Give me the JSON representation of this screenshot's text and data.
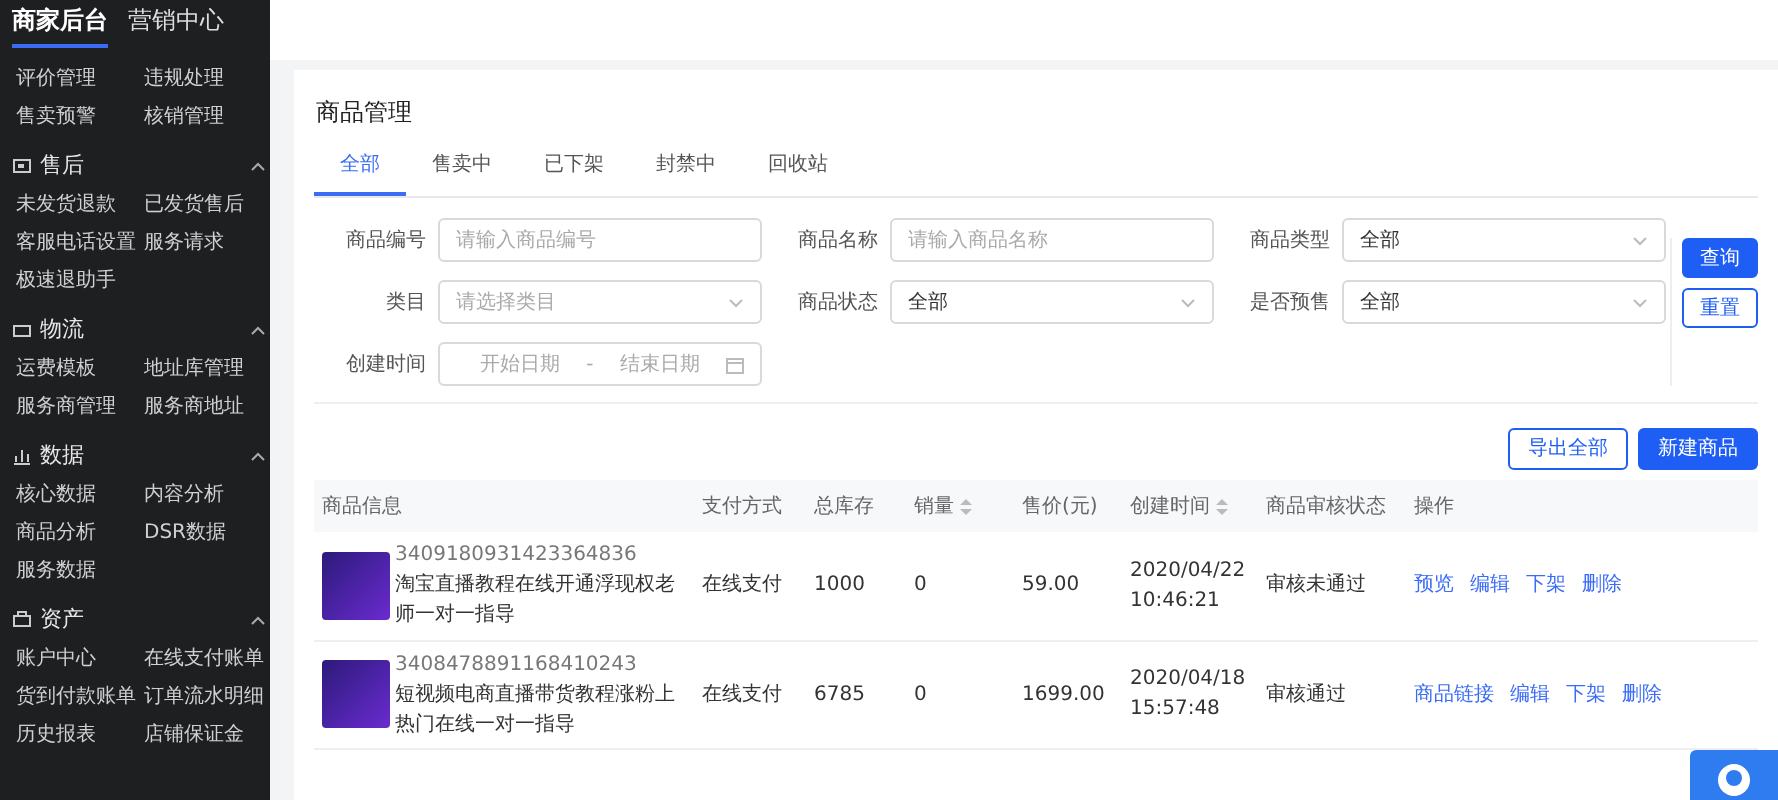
{
  "sidebar": {
    "top_tabs": [
      {
        "label": "商家后台",
        "selected": true
      },
      {
        "label": "营销中心",
        "selected": false
      }
    ],
    "groups": [
      {
        "items": [
          "评价管理",
          "违规处理",
          "售卖预警",
          "核销管理"
        ]
      },
      {
        "kind": "aftersale",
        "title": "售后",
        "expanded": true,
        "items": [
          "未发货退款",
          "已发货售后",
          "客服电话设置",
          "服务请求",
          "极速退助手"
        ]
      },
      {
        "kind": "logistics",
        "title": "物流",
        "expanded": true,
        "items": [
          "运费模板",
          "地址库管理",
          "服务商管理",
          "服务商地址"
        ]
      },
      {
        "kind": "data",
        "title": "数据",
        "expanded": true,
        "items": [
          "核心数据",
          "内容分析",
          "商品分析",
          "DSR数据",
          "服务数据"
        ]
      },
      {
        "kind": "assets",
        "title": "资产",
        "expanded": true,
        "items": [
          "账户中心",
          "在线支付账单",
          "货到付款账单",
          "订单流水明细",
          "历史报表",
          "店铺保证金"
        ]
      }
    ]
  },
  "page": {
    "title": "商品管理",
    "tabs": [
      {
        "label": "全部",
        "selected": true
      },
      {
        "label": "售卖中",
        "selected": false
      },
      {
        "label": "已下架",
        "selected": false
      },
      {
        "label": "封禁中",
        "selected": false
      },
      {
        "label": "回收站",
        "selected": false
      }
    ],
    "filters": [
      {
        "kind": "text",
        "label": "商品编号",
        "placeholder": "请输入商品编号"
      },
      {
        "kind": "text",
        "label": "商品名称",
        "placeholder": "请输入商品名称"
      },
      {
        "kind": "select",
        "label": "商品类型",
        "value": "全部"
      },
      {
        "kind": "select",
        "label": "类目",
        "placeholder": "请选择类目"
      },
      {
        "kind": "select",
        "label": "商品状态",
        "value": "全部"
      },
      {
        "kind": "select",
        "label": "是否预售",
        "value": "全部"
      },
      {
        "kind": "daterange",
        "label": "创建时间",
        "start_placeholder": "开始日期",
        "separator": "-",
        "end_placeholder": "结束日期"
      }
    ],
    "search_buttons": [
      {
        "label": "查询",
        "primary": true
      },
      {
        "label": "重置",
        "primary": false
      }
    ],
    "action_buttons": [
      {
        "label": "导出全部",
        "primary": false
      },
      {
        "label": "新建商品",
        "primary": true
      }
    ]
  },
  "table": {
    "columns": [
      {
        "label": "商品信息",
        "sortable": false
      },
      {
        "label": "支付方式",
        "sortable": false
      },
      {
        "label": "总库存",
        "sortable": false
      },
      {
        "label": "销量",
        "sortable": true
      },
      {
        "label": "售价(元)",
        "sortable": false
      },
      {
        "label": "创建时间",
        "sortable": true
      },
      {
        "label": "商品审核状态",
        "sortable": false
      },
      {
        "label": "操作",
        "sortable": false
      }
    ],
    "rows": [
      {
        "id": "3409180931423364836",
        "name": "淘宝直播教程在线开通浮现权老师一对一指导",
        "payment": "在线支付",
        "stock": "1000",
        "sales": "0",
        "price": "59.00",
        "created_date": "2020/04/22",
        "created_time": "10:46:21",
        "review": "审核未通过",
        "actions": [
          "预览",
          "编辑",
          "下架",
          "删除"
        ]
      },
      {
        "id": "3408478891168410243",
        "name": "短视频电商直播带货教程涨粉上热门在线一对一指导",
        "payment": "在线支付",
        "stock": "6785",
        "sales": "0",
        "price": "1699.00",
        "created_date": "2020/04/18",
        "created_time": "15:57:48",
        "review": "审核通过",
        "actions": [
          "商品链接",
          "编辑",
          "下架",
          "删除"
        ]
      }
    ]
  }
}
